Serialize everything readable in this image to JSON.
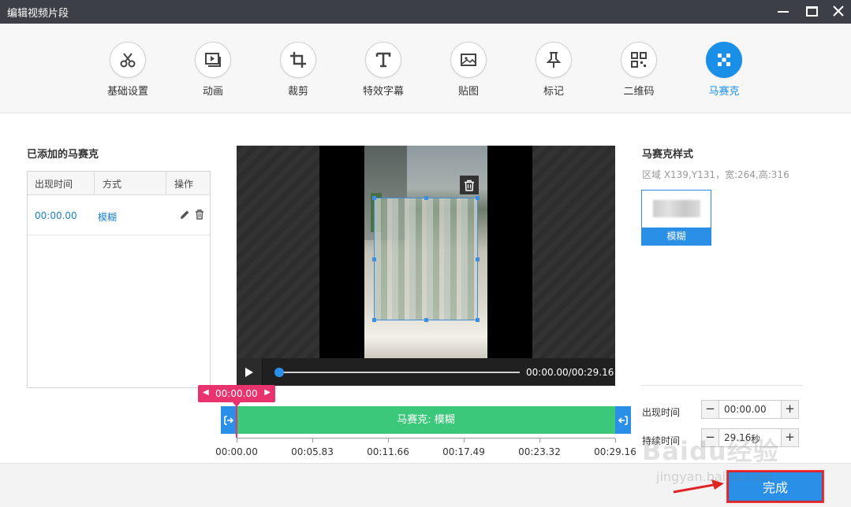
{
  "window": {
    "title": "编辑视频片段"
  },
  "toolbar": {
    "items": [
      {
        "label": "基础设置",
        "icon": "scissors-icon"
      },
      {
        "label": "动画",
        "icon": "film-play-icon"
      },
      {
        "label": "裁剪",
        "icon": "crop-icon"
      },
      {
        "label": "特效字幕",
        "icon": "text-icon"
      },
      {
        "label": "贴图",
        "icon": "image-icon"
      },
      {
        "label": "标记",
        "icon": "pin-icon"
      },
      {
        "label": "二维码",
        "icon": "qrcode-icon"
      },
      {
        "label": "马赛克",
        "icon": "mosaic-icon"
      }
    ],
    "active": "马赛克",
    "accent_color": "#1a8fe8"
  },
  "left_panel": {
    "title": "已添加的马赛克",
    "columns": [
      "出现时间",
      "方式",
      "操作"
    ],
    "rows": [
      {
        "time": "00:00.00",
        "mode": "模糊"
      }
    ]
  },
  "player": {
    "time_display": "00:00.00/00:29.16",
    "progress": 0
  },
  "right_panel": {
    "title": "马赛克样式",
    "region_info": "区域 X139,Y131，宽:264,高:316",
    "style_label": "模糊",
    "appear_label": "出现时间",
    "appear_value": "00:00.00",
    "duration_label": "持续时间",
    "duration_value": "29.16",
    "duration_unit": "秒"
  },
  "timeline": {
    "current_tag": "00:00.00",
    "clip_label": "马赛克: 模糊",
    "ticks": [
      "00:00.00",
      "00:05.83",
      "00:11.66",
      "00:17.49",
      "00:23.32",
      "00:29.16"
    ],
    "clip_color": "#3cc87a",
    "marker_color": "#e8336e"
  },
  "footer": {
    "done_label": "完成"
  },
  "watermark": {
    "brand": "Baidu经验",
    "url": "jingyan.baidu.com"
  }
}
